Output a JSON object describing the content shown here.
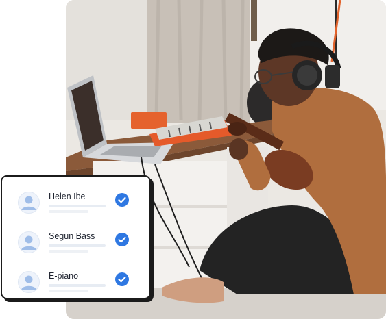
{
  "card": {
    "items": [
      {
        "name": "Helen Ibe",
        "checked": true
      },
      {
        "name": "Segun Bass",
        "checked": true
      },
      {
        "name": "E-piano",
        "checked": true
      }
    ]
  },
  "colors": {
    "accent": "#2f78e2",
    "card_border": "#1b1b1b",
    "avatar_bg": "#eef3fb",
    "avatar_fg": "#9fbde8"
  },
  "icons": [
    "user-avatar-icon",
    "checkmark-icon"
  ]
}
